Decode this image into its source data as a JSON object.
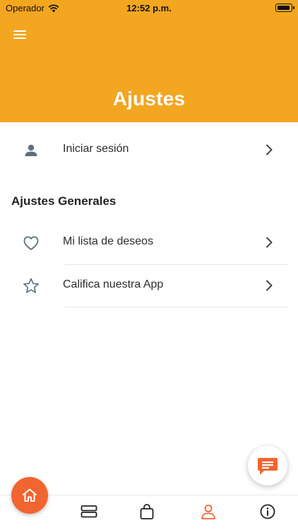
{
  "status_bar": {
    "carrier": "Operador",
    "time": "12:52 p.m."
  },
  "header": {
    "title": "Ajustes"
  },
  "login": {
    "label": "Iniciar sesión"
  },
  "general": {
    "title": "Ajustes Generales",
    "items": [
      {
        "label": "Mi lista de deseos",
        "icon": "heart-icon"
      },
      {
        "label": "Califica nuestra App",
        "icon": "star-icon"
      }
    ]
  },
  "colors": {
    "header": "#f3a620",
    "accent": "#f26430",
    "icon": "#5f6f7d"
  }
}
